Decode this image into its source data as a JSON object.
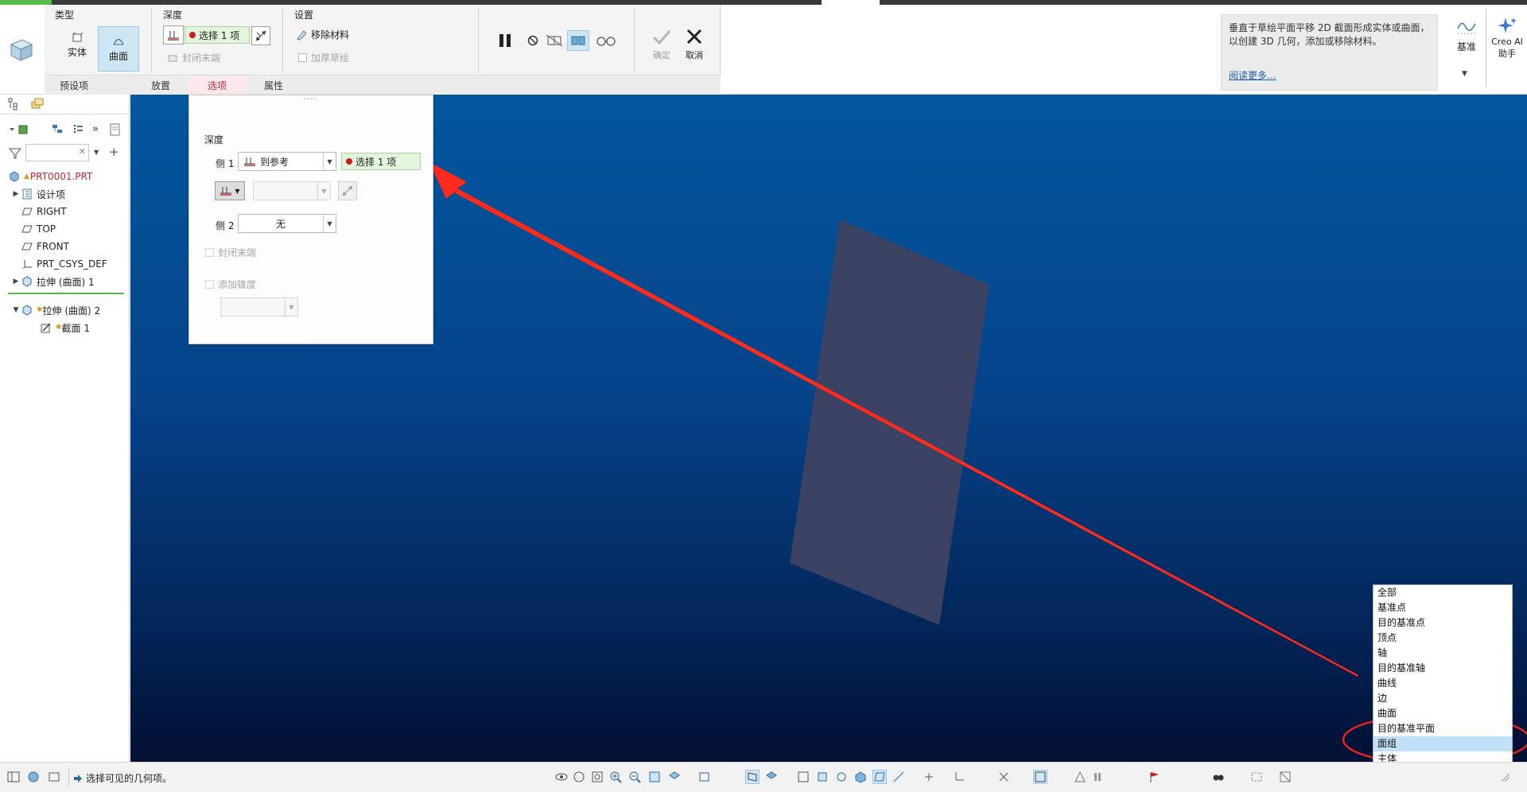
{
  "ribbon": {
    "groups": {
      "type": "类型",
      "depth": "深度",
      "settings": "设置"
    },
    "type_buttons": {
      "solid": "实体",
      "surface": "曲面"
    },
    "depth_select": "选择 1 项",
    "cap_ends": "封闭末端",
    "remove_material": "移除材料",
    "thicken_sketch": "加厚草绘",
    "ok": "确定",
    "cancel": "取消",
    "tabs": [
      "预设项",
      "放置",
      "选项",
      "属性"
    ],
    "help_text": "垂直于草绘平面平移 2D 截面形成实体或曲面，以创建 3D 几何，添加或移除材料。",
    "help_link": "阅读更多...",
    "datum": "基准",
    "creo_ai_line1": "Creo AI",
    "creo_ai_line2": "助手"
  },
  "tree": {
    "items": [
      {
        "label": "PRT0001.PRT",
        "icon": "part-icon"
      },
      {
        "label": "设计项",
        "icon": "design-items-icon"
      },
      {
        "label": "RIGHT",
        "icon": "datum-plane-icon"
      },
      {
        "label": "TOP",
        "icon": "datum-plane-icon"
      },
      {
        "label": "FRONT",
        "icon": "datum-plane-icon"
      },
      {
        "label": "PRT_CSYS_DEF",
        "icon": "csys-icon"
      },
      {
        "label": "拉伸 (曲面) 1",
        "icon": "extrude-icon"
      },
      {
        "label": "拉伸 (曲面) 2",
        "icon": "extrude-icon"
      },
      {
        "label": "截面 1",
        "icon": "sketch-icon"
      }
    ]
  },
  "options_panel": {
    "section": "深度",
    "side1_label": "侧 1",
    "side1_value": "到参考",
    "side1_select": "选择 1 项",
    "side2_label": "侧 2",
    "side2_value": "无",
    "cap_ends": "封闭末端",
    "add_taper": "添加锥度"
  },
  "filter_list": {
    "items": [
      "全部",
      "基准点",
      "目的基准点",
      "顶点",
      "轴",
      "目的基准轴",
      "曲线",
      "边",
      "曲面",
      "目的基准平面",
      "面组",
      "主体",
      "面组"
    ],
    "selected_index": 10
  },
  "status": {
    "message": "选择可见的几何项。"
  },
  "colors": {
    "accent_red": "#c22e35",
    "arrow_red": "#ff2a1a",
    "select_green": "#e4f5dd"
  }
}
